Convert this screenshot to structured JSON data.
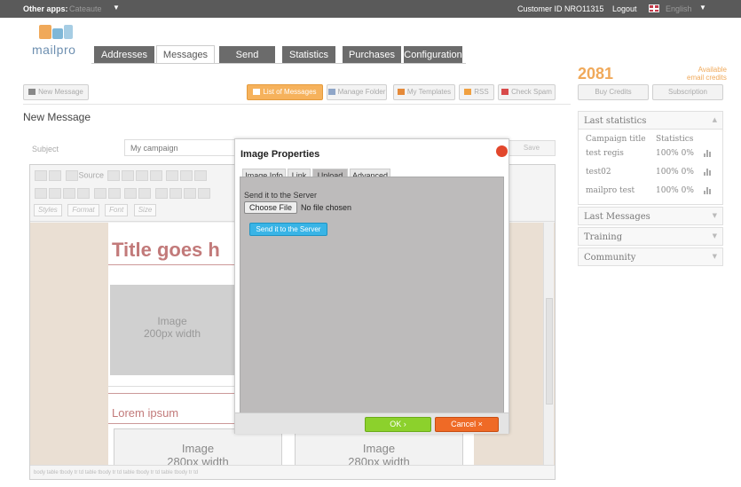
{
  "topbar": {
    "other_apps_label": "Other apps:",
    "other_apps_value": "Cateaute",
    "customer_id": "Customer ID NRO11315",
    "logout": "Logout",
    "language": "English"
  },
  "logo": {
    "text": "mailpro"
  },
  "nav": {
    "tabs": [
      {
        "label": "Addresses"
      },
      {
        "label": "Messages"
      },
      {
        "label": "Send"
      },
      {
        "label": "Statistics"
      },
      {
        "label": "Purchases"
      },
      {
        "label": "Configuration"
      }
    ]
  },
  "credits": {
    "value": "2081",
    "available_line1": "Available",
    "available_line2": "email credits",
    "buy_label": "Buy Credits",
    "subscription_label": "Subscription"
  },
  "toolbar": {
    "new_message": "New Message",
    "list_messages": "List of Messages",
    "manage_folder": "Manage Folder",
    "my_templates": "My Templates",
    "rss": "RSS",
    "check_spam": "Check Spam"
  },
  "page_title": "New Message",
  "subject": {
    "label": "Subject",
    "value": "My campaign"
  },
  "save_label": "Save",
  "editor": {
    "source_label": "Source",
    "styles_placeholder": "Styles",
    "format_placeholder": "Format",
    "font_placeholder": "Font",
    "size_placeholder": "Size",
    "title_text": "Title goes h",
    "image_main": [
      "Image",
      "200px width"
    ],
    "lorem": "Lorem ipsum",
    "image_a": [
      "Image",
      "280px width"
    ],
    "image_b": [
      "Image",
      "280px width"
    ],
    "status_path": "body table tbody tr td table tbody tr td table tbody tr td table tbody tr td"
  },
  "dialog": {
    "title": "Image Properties",
    "tabs": [
      "Image Info",
      "Link",
      "Upload",
      "Advanced"
    ],
    "active_tab": "Upload",
    "send_label": "Send it to the Server",
    "choose_file": "Choose File",
    "no_file": "No file chosen",
    "send_button": "Send it to the Server",
    "ok": "OK",
    "cancel": "Cancel"
  },
  "sidebar": {
    "last_statistics": "Last statistics",
    "campaign_title_header": "Campaign title",
    "statistics_header": "Statistics",
    "rows": [
      {
        "name": "test regis",
        "stats": "100% 0%"
      },
      {
        "name": "test02",
        "stats": "100% 0%"
      },
      {
        "name": "mailpro test",
        "stats": "100% 0%"
      }
    ],
    "last_messages": "Last Messages",
    "training": "Training",
    "community": "Community"
  },
  "colors": {
    "accent_orange": "#f6b25c",
    "ok_green": "#8cd12c",
    "cancel_orange": "#ef6a26",
    "send_blue": "#39b4e6"
  }
}
